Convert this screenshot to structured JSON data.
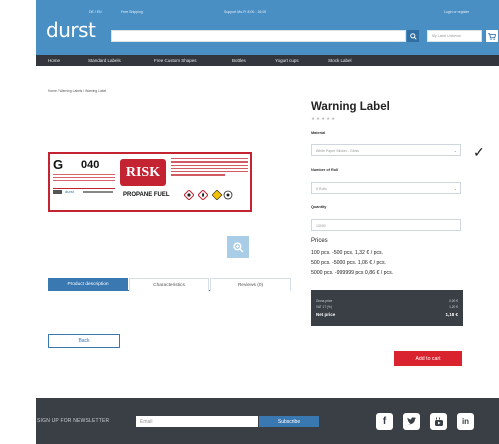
{
  "header": {
    "logo": "durst",
    "top_lang": "DE / EN",
    "top_shipping": "Free Shipping",
    "top_support": "Support Mo-Fr 8:00 - 16:00",
    "top_login": "Login or register",
    "category_placeholder": "My Label Universe"
  },
  "nav": {
    "items": [
      "Home",
      "Standard Labels",
      "Free Custom Shapes",
      "Bottles",
      "Yogurt cups",
      "Stock Label"
    ]
  },
  "breadcrumb": "Home / Warning Labels / Warning Label",
  "product_image": {
    "code_letter": "G",
    "code_number": "040",
    "main_word": "RISK",
    "sub_word": "PROPANE FUEL",
    "brand": "durst"
  },
  "product": {
    "title": "Warning Label",
    "stars": "★★★★★",
    "material_label": "Material",
    "material_value": "White Paper Sticker - Gloss",
    "rolls_label": "Number of Roll",
    "rolls_value": "5 Rolls",
    "quantity_label": "Quantity",
    "quantity_value": "10000"
  },
  "prices": {
    "title": "Prices",
    "rows": [
      "100 pcs. -500 pcs.    1,32 € / pcs.",
      "500 pcs. -5000 pcs.   1,06 € / pcs.",
      "5000 pcs. -999999 pcs 0,86 € / pcs."
    ]
  },
  "summary": {
    "gross_label": "Gross price",
    "gross_value": "0,00 €",
    "vat_label": "VAT 17 (%)",
    "vat_value": "1,20 €",
    "net_label": "Net price",
    "net_value": "1,18 €"
  },
  "tabs": [
    "Product description",
    "Characteristics",
    "Reviews (0)"
  ],
  "buttons": {
    "back": "Back",
    "add_to_cart": "Add to cart"
  },
  "footer": {
    "newsletter_label": "SIGN UP FOR NEWSLETTER",
    "email_placeholder": "Email",
    "subscribe": "Subscribe",
    "social": [
      "facebook-icon",
      "twitter-icon",
      "youtube-icon",
      "linkedin-icon"
    ]
  },
  "colors": {
    "header_blue": "#4a8fc4",
    "nav_dark": "#33373d",
    "accent_blue": "#3a78b2",
    "cart_red": "#d9232e",
    "label_red": "#c42331"
  }
}
